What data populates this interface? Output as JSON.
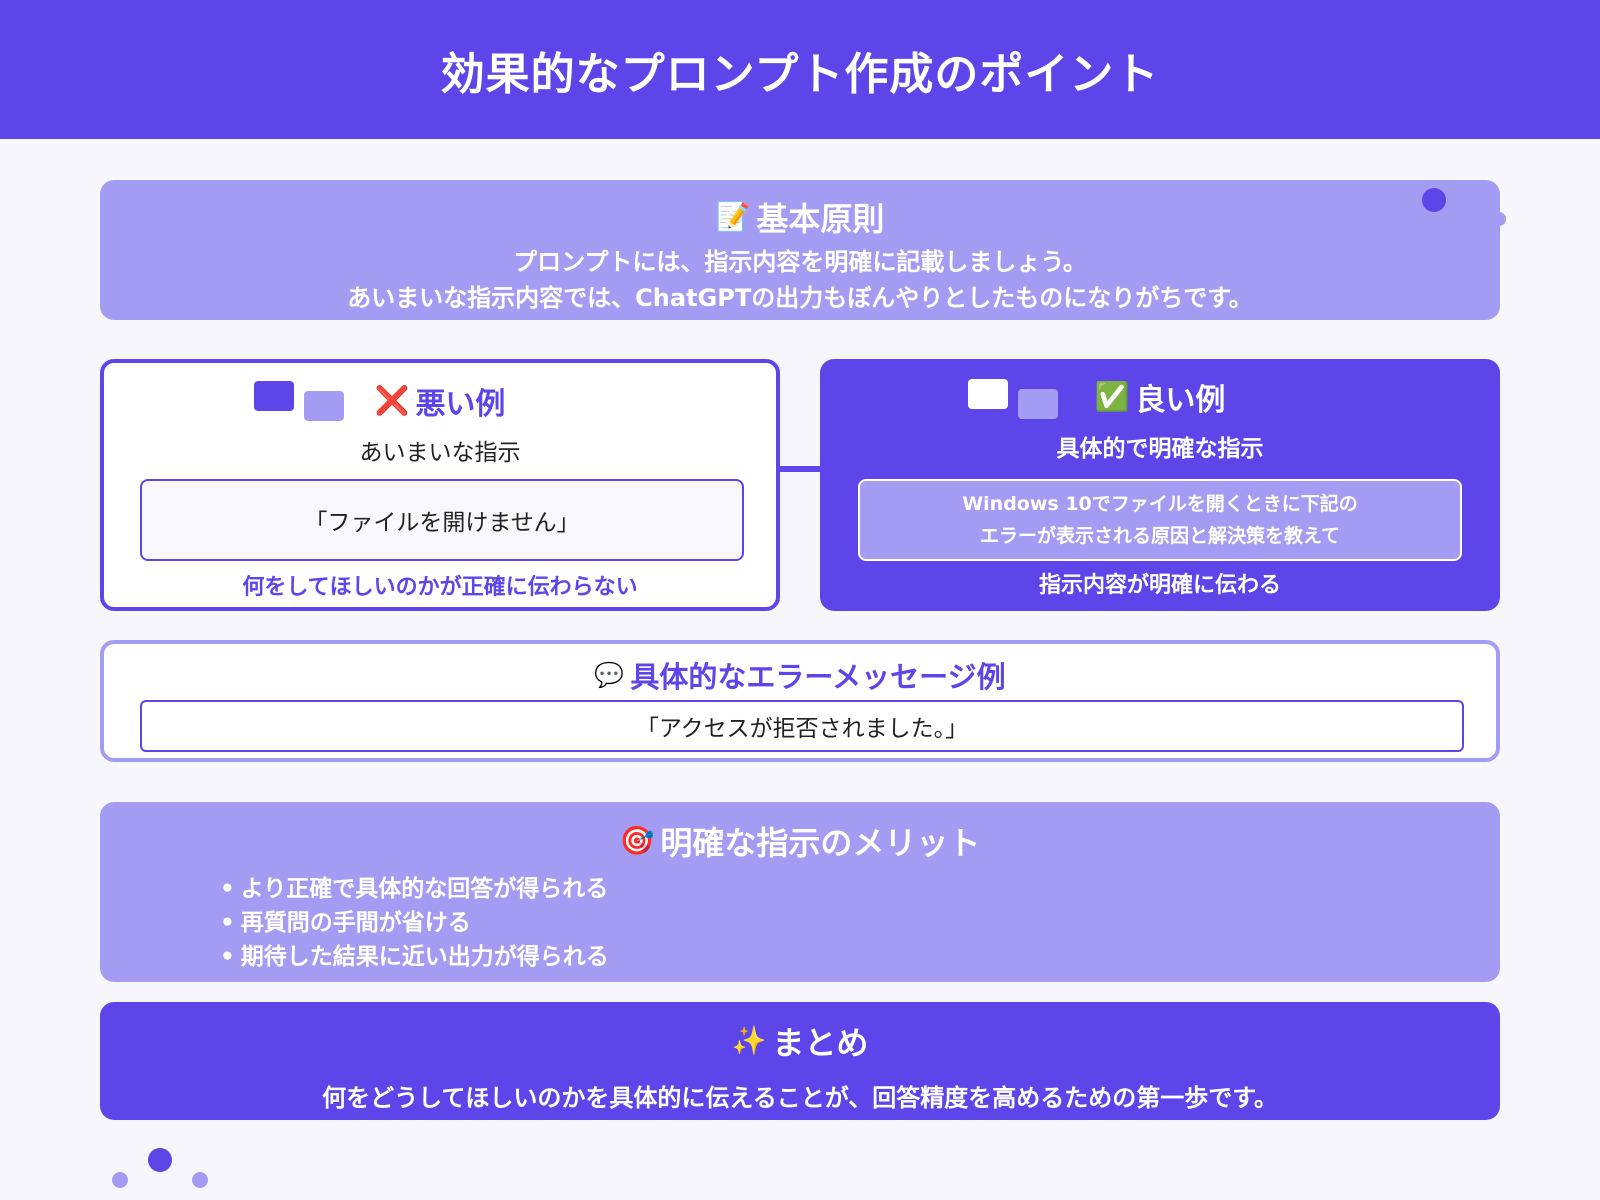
{
  "page": {
    "title": "効果的なプロンプト作成のポイント"
  },
  "principles": {
    "icon": "memo-icon",
    "emoji": "📝",
    "title": "基本原則",
    "line1": "プロンプトには、指示内容を明確に記載しましょう。",
    "line2": "あいまいな指示内容では、ChatGPTの出力もぼんやりとしたものになりがちです。"
  },
  "bad_example": {
    "icon": "cross-mark-icon",
    "emoji": "❌",
    "title": "悪い例",
    "subtitle": "あいまいな指示",
    "example": "「ファイルを開けません」",
    "verdict": "何をしてほしいのかが正確に伝わらない"
  },
  "good_example": {
    "icon": "check-mark-icon",
    "emoji": "✅",
    "title": "良い例",
    "subtitle": "具体的で明確な指示",
    "example_line1": "Windows 10でファイルを開くときに下記の",
    "example_line2": "エラーが表示される原因と解決策を教えて",
    "verdict": "指示内容が明確に伝わる"
  },
  "error_message": {
    "icon": "speech-bubble-icon",
    "emoji": "💬",
    "title": "具体的なエラーメッセージ例",
    "text": "「アクセスが拒否されました。」"
  },
  "merits": {
    "icon": "target-icon",
    "emoji": "🎯",
    "title": "明確な指示のメリット",
    "items": [
      "より正確で具体的な回答が得られる",
      "再質問の手間が省ける",
      "期待した結果に近い出力が得られる"
    ]
  },
  "summary": {
    "icon": "sparkles-icon",
    "emoji": "✨",
    "title": "まとめ",
    "text": "何をどうしてほしいのかを具体的に伝えることが、回答精度を高めるための第一歩です。"
  },
  "colors": {
    "primary": "#5d45ea",
    "light": "#a49cf2",
    "background": "#f7f6fd",
    "white": "#ffffff"
  }
}
